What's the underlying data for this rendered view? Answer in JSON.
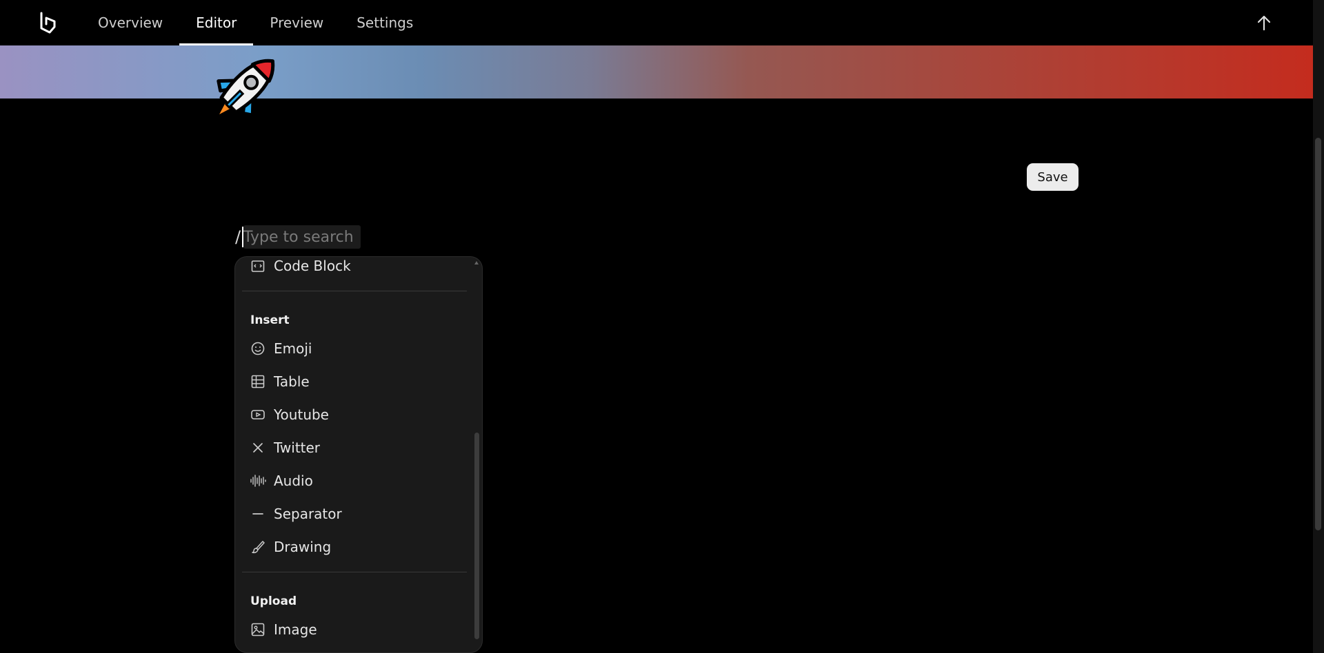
{
  "nav": {
    "tabs": [
      {
        "label": "Overview"
      },
      {
        "label": "Editor"
      },
      {
        "label": "Preview"
      },
      {
        "label": "Settings"
      }
    ],
    "active": "Editor"
  },
  "editor": {
    "save_label": "Save",
    "slash": "/",
    "search_placeholder": "Type to search"
  },
  "menu": {
    "code_block": {
      "label": "Code Block",
      "icon": "code-block-icon"
    },
    "insert": {
      "title": "Insert",
      "items": [
        {
          "label": "Emoji",
          "icon": "emoji-icon"
        },
        {
          "label": "Table",
          "icon": "table-icon"
        },
        {
          "label": "Youtube",
          "icon": "youtube-icon"
        },
        {
          "label": "Twitter",
          "icon": "x-icon"
        },
        {
          "label": "Audio",
          "icon": "audio-waveform-icon"
        },
        {
          "label": "Separator",
          "icon": "minus-icon"
        },
        {
          "label": "Drawing",
          "icon": "brush-icon"
        }
      ]
    },
    "upload": {
      "title": "Upload",
      "items": [
        {
          "label": "Image",
          "icon": "image-icon"
        }
      ]
    }
  },
  "colors": {
    "banner_start": "#9a92c2",
    "banner_end": "#c42c1e",
    "menu_bg": "#1a1a1a"
  }
}
